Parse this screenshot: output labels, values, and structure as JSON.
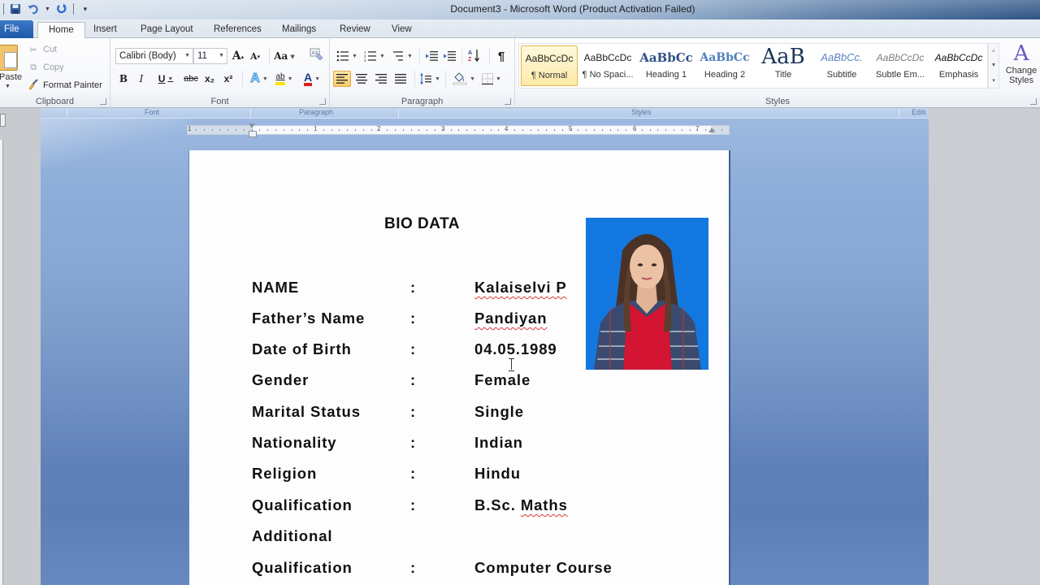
{
  "window": {
    "title": "Document3  -  Microsoft Word (Product Activation Failed)"
  },
  "quick_access": {
    "save_icon": "save-icon",
    "undo_icon": "undo-icon",
    "redo_icon": "redo-icon",
    "customize_icon": "customize-qat-icon"
  },
  "tabs": [
    {
      "label": "File"
    },
    {
      "label": "Home",
      "active": true
    },
    {
      "label": "Insert"
    },
    {
      "label": "Page Layout"
    },
    {
      "label": "References"
    },
    {
      "label": "Mailings"
    },
    {
      "label": "Review"
    },
    {
      "label": "View"
    }
  ],
  "ribbon": {
    "clipboard": {
      "label": "Clipboard",
      "paste": "Paste",
      "cut": "Cut",
      "copy": "Copy",
      "format_painter": "Format Painter"
    },
    "font": {
      "label": "Font",
      "font_name": "Calibri (Body)",
      "font_size": "11",
      "grow": "A",
      "shrink": "A",
      "change_case": "Aa",
      "bold": "B",
      "italic": "I",
      "underline": "U",
      "strikethrough": "abc",
      "subscript": "x₂",
      "superscript": "x²",
      "text_effects": "A",
      "highlight": "ab",
      "font_color": "A",
      "highlight_color": "#f5e400",
      "font_color_value": "#d9221c"
    },
    "paragraph": {
      "label": "Paragraph",
      "sort": "A↓",
      "show_marks": "¶",
      "active_alignment": "left"
    },
    "styles": {
      "label": "Styles",
      "items": [
        {
          "sample": "AaBbCcDc",
          "name": "¶ Normal",
          "active": true
        },
        {
          "sample": "AaBbCcDc",
          "name": "¶ No Spaci..."
        },
        {
          "sample": "AaBbCc",
          "name": "Heading 1"
        },
        {
          "sample": "AaBbCc",
          "name": "Heading 2"
        },
        {
          "sample": "AaB",
          "name": "Title"
        },
        {
          "sample": "AaBbCc.",
          "name": "Subtitle"
        },
        {
          "sample": "AaBbCcDc",
          "name": "Subtle Em..."
        },
        {
          "sample": "AaBbCcDc",
          "name": "Emphasis"
        }
      ],
      "change_styles": "Change Styles"
    }
  },
  "collapsed_strip": {
    "font": "Font",
    "paragraph": "Paragraph",
    "styles": "Styles",
    "editing": "Editi"
  },
  "ruler": {
    "numbers": [
      "1",
      "1",
      "2",
      "3",
      "4",
      "5",
      "6",
      "7"
    ]
  },
  "document": {
    "title": "BIO DATA",
    "rows": [
      {
        "label": "NAME",
        "colon": ":",
        "value": "Kalaiselvi P",
        "spell_flag": true
      },
      {
        "label": "Father’s Name",
        "colon": ":",
        "value": "Pandiyan",
        "spell_flag": true
      },
      {
        "label": "Date of Birth",
        "colon": ":",
        "value": "04.05.1989"
      },
      {
        "label": "Gender",
        "colon": ":",
        "value": "Female"
      },
      {
        "label": "Marital Status",
        "colon": ":",
        "value": "Single"
      },
      {
        "label": "Nationality",
        "colon": ":",
        "value": "Indian"
      },
      {
        "label": "Religion",
        "colon": ":",
        "value": "Hindu"
      },
      {
        "label": "Qualification",
        "colon": ":",
        "value": "B.Sc. Maths",
        "spell_flag_word": "Maths"
      },
      {
        "label": "Additional",
        "colon": "",
        "value": ""
      },
      {
        "label": "Qualification",
        "colon": ":",
        "value": "Computer Course"
      }
    ],
    "photo": {
      "description": "Passport photo of a woman with long hair, red top and plaid jacket",
      "background_color": "#1377e0"
    }
  }
}
